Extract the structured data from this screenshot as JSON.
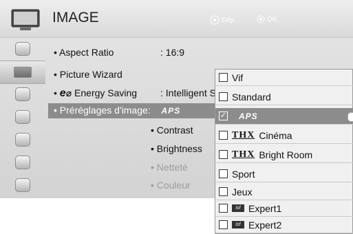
{
  "header": {
    "title": "IMAGE",
    "hint_move": "Dép.",
    "hint_ok": "OK",
    "icon": "tv-icon"
  },
  "sidebar": {
    "items": [
      {
        "icon": "disc-icon"
      },
      {
        "icon": "picture-icon"
      },
      {
        "icon": "audio-icon"
      },
      {
        "icon": "time-icon"
      },
      {
        "icon": "lock-icon"
      },
      {
        "icon": "options-icon"
      },
      {
        "icon": "network-icon"
      }
    ]
  },
  "menu": {
    "aspect_label": "• Aspect Ratio",
    "aspect_value": ": 16:9",
    "wizard_label": "• Picture Wizard",
    "energy_bullet": "•",
    "energy_logo": "e",
    "energy_label": "Energy Saving",
    "energy_value": ": Intelligent Se",
    "presets_label": "• Préréglages d'image:",
    "presets_value": "APS",
    "contrast": "• Contrast",
    "brightness": "• Brightness",
    "sharpness": "• Netteté",
    "color": "• Couleur"
  },
  "dropdown": {
    "options": [
      {
        "label": "Vif",
        "logo": ""
      },
      {
        "label": "Standard",
        "logo": ""
      },
      {
        "label": "",
        "logo": "APS"
      },
      {
        "label": "Cinéma",
        "logo": "THX"
      },
      {
        "label": "Bright Room",
        "logo": "THX"
      },
      {
        "label": "Sport",
        "logo": ""
      },
      {
        "label": "Jeux",
        "logo": ""
      },
      {
        "label": "Expert1",
        "logo": "isf"
      },
      {
        "label": "Expert2",
        "logo": "isf"
      }
    ],
    "selected_index": 2,
    "check_mark": "✓"
  }
}
